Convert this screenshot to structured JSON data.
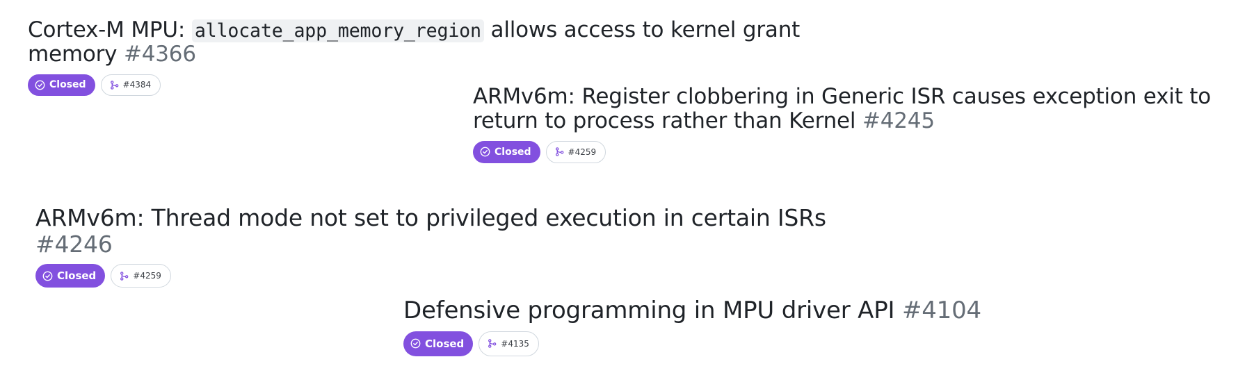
{
  "accent_color": "#8250df",
  "issues": [
    {
      "title_before": "Cortex-M MPU: ",
      "title_code": "allocate_app_memory_region",
      "title_after": " allows access to kernel grant memory",
      "number": "#4366",
      "state": "Closed",
      "state_icon": "check-circle-icon",
      "linked_pr": "#4384",
      "linked_pr_icon": "git-merge-icon"
    },
    {
      "title": "ARMv6m: Register clobbering in Generic ISR causes exception exit to return to process rather than Kernel",
      "number": "#4245",
      "state": "Closed",
      "state_icon": "check-circle-icon",
      "linked_pr": "#4259",
      "linked_pr_icon": "git-merge-icon"
    },
    {
      "title": "ARMv6m: Thread mode not set to privileged execution in certain ISRs",
      "number": "#4246",
      "state": "Closed",
      "state_icon": "check-circle-icon",
      "linked_pr": "#4259",
      "linked_pr_icon": "git-merge-icon"
    },
    {
      "title": "Defensive programming in MPU driver API",
      "number": "#4104",
      "state": "Closed",
      "state_icon": "check-circle-icon",
      "linked_pr": "#4135",
      "linked_pr_icon": "git-merge-icon"
    }
  ]
}
